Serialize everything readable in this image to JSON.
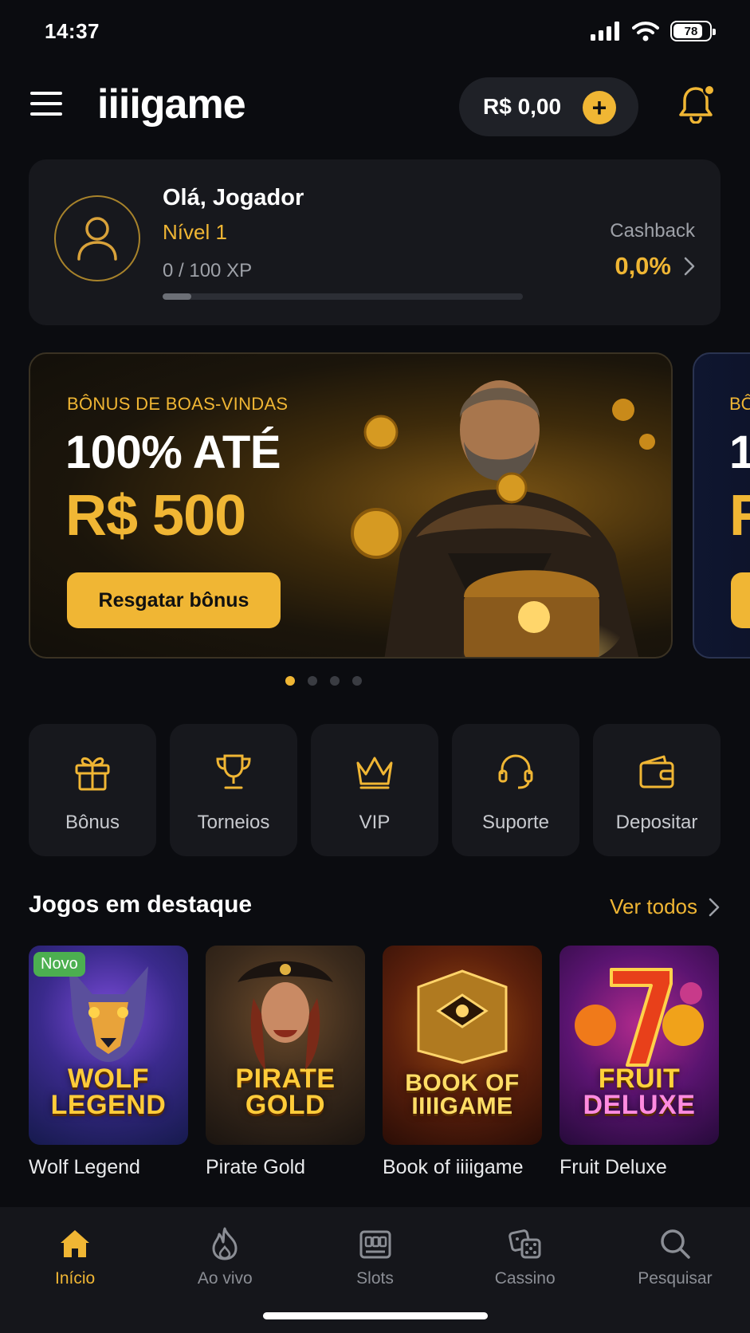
{
  "status_bar": {
    "time": "14:37",
    "battery": "78"
  },
  "header": {
    "logo": "iiiigame",
    "balance": "R$ 0,00",
    "plus": "+"
  },
  "profile": {
    "greeting": "Olá, Jogador",
    "level": "Nível 1",
    "xp": "0 / 100 XP",
    "xp_progress": 0.08,
    "cashback_label": "Cashback",
    "cashback_value": "0,0%"
  },
  "banner": {
    "subtitle": "BÔNUS DE BOAS-VINDAS",
    "line1": "100% ATÉ",
    "line2": "R$ 500",
    "button": "Resgatar bônus",
    "next_subtitle": "BÔ",
    "next_line1": "1",
    "next_line2": "R"
  },
  "carousel": {
    "count": 4,
    "active": 0
  },
  "quick_actions": [
    {
      "label": "Bônus",
      "icon": "gift-icon"
    },
    {
      "label": "Torneios",
      "icon": "trophy-icon"
    },
    {
      "label": "VIP",
      "icon": "crown-icon"
    },
    {
      "label": "Suporte",
      "icon": "headset-icon"
    },
    {
      "label": "Depositar",
      "icon": "wallet-icon"
    }
  ],
  "featured": {
    "title": "Jogos em destaque",
    "see_all": "Ver todos",
    "games": [
      {
        "name": "Wolf Legend",
        "art_line1": "WOLF",
        "art_line2": "LEGEND",
        "badge": "Novo"
      },
      {
        "name": "Pirate Gold",
        "art_line1": "PIRATE",
        "art_line2": "GOLD"
      },
      {
        "name": "Book of iiiigame",
        "art_line1": "BOOK OF",
        "art_line2": "IIIIGAME"
      },
      {
        "name": "Fruit Deluxe",
        "art_line1": "FRUIT",
        "art_line2": "DELUXE"
      }
    ]
  },
  "bottom_nav": [
    {
      "label": "Início",
      "icon": "home-icon",
      "active": true
    },
    {
      "label": "Ao vivo",
      "icon": "flame-icon"
    },
    {
      "label": "Slots",
      "icon": "slot-machine-icon"
    },
    {
      "label": "Cassino",
      "icon": "dice-icon"
    },
    {
      "label": "Pesquisar",
      "icon": "search-icon"
    }
  ],
  "colors": {
    "accent": "#f0b634",
    "background": "#0b0c10",
    "card": "#17181d"
  }
}
